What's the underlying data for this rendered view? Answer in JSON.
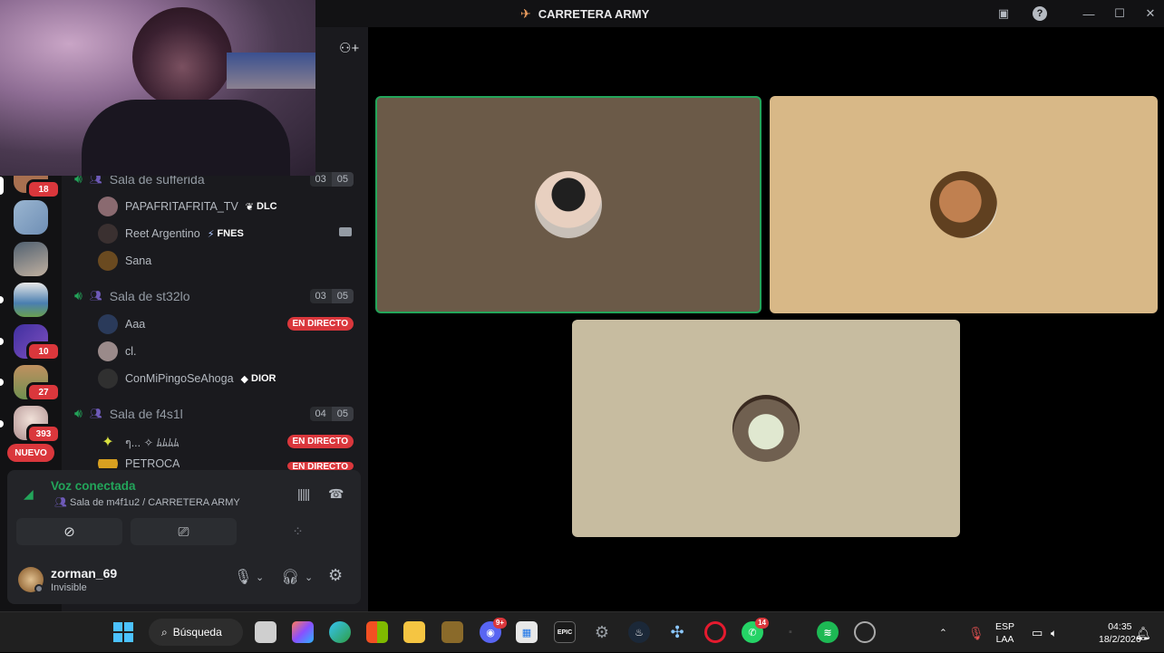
{
  "window": {
    "title": "CARRETERA ARMY"
  },
  "guild_badges": [
    "18",
    "10",
    "27",
    "393"
  ],
  "guild_new_label": "NUEVO",
  "voice_channels": [
    {
      "name": "Sala de sufferida",
      "count_a": "03",
      "count_b": "05",
      "members": [
        {
          "name": "PAPAFRITAFRITA_TV",
          "tag": "DLC",
          "tag_icon": "leaf-icon"
        },
        {
          "name": "Reet Argentino",
          "tag": "FNES",
          "tag_icon": "bolt-icon",
          "camera": true
        },
        {
          "name": "Sana"
        }
      ]
    },
    {
      "name": "Sala de st32lo",
      "count_a": "03",
      "count_b": "05",
      "members": [
        {
          "name": "Aaa",
          "live": "EN DIRECTO"
        },
        {
          "name": "cl."
        },
        {
          "name": "ConMiPingoSeAhoga",
          "tag": "DIOR",
          "tag_icon": "diamond-icon"
        }
      ]
    },
    {
      "name": "Sala de f4s1l",
      "count_a": "04",
      "count_b": "05",
      "members": [
        {
          "name": "ๆ... ✧ ﾑﾑﾑﾑ",
          "live": "EN DIRECTO"
        },
        {
          "name": "PETROCA",
          "live": "EN DIRECTO"
        }
      ]
    }
  ],
  "voice_panel": {
    "status": "Voz conectada",
    "location": "Sala de m4f1u2 / CARRETERA ARMY"
  },
  "user": {
    "name": "zorman_69",
    "status": "Invisible"
  },
  "taskbar": {
    "search_label": "Búsqueda",
    "discord_badge": "9+",
    "whatsapp_badge": "14",
    "language": "ESP",
    "layout": "LAA",
    "time": "04:35",
    "date": "18/2/2026"
  },
  "colors": {
    "accent_green": "#23a55a",
    "danger_red": "#da373c",
    "tile1": "#6b5a48",
    "tile2": "#d8b887",
    "tile3": "#c7bca0"
  }
}
